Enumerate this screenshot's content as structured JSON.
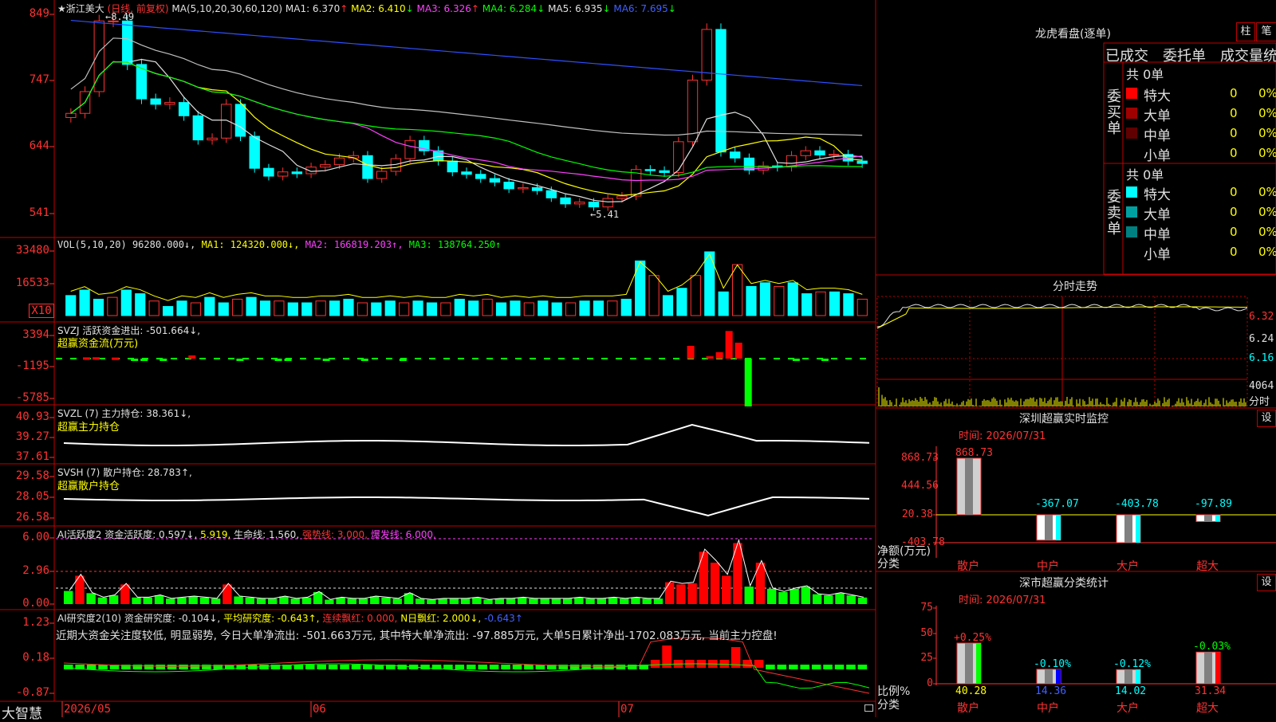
{
  "stock": {
    "name": "★浙江美大",
    "mode": "(日线, 前复权)",
    "ma_label": "MA(5,10,20,30,60,120)",
    "ma": [
      {
        "label": "MA1: 6.370",
        "arrow": "↑",
        "color": "#e0e0e0"
      },
      {
        "label": "MA2: 6.410",
        "arrow": "↓",
        "color": "#ffff00"
      },
      {
        "label": "MA3: 6.326",
        "arrow": "↑",
        "color": "#ff40ff"
      },
      {
        "label": "MA4: 6.284",
        "arrow": "↓",
        "color": "#00ff00"
      },
      {
        "label": "MA5: 6.935",
        "arrow": "↓",
        "color": "#e0e0e0"
      },
      {
        "label": "MA6: 7.695",
        "arrow": "↓",
        "color": "#4060ff"
      }
    ],
    "high_mark": "←8.49",
    "low_mark": "←5.41",
    "price_axis": [
      "849",
      "747",
      "644",
      "541"
    ],
    "closes": [
      6.96,
      7.32,
      8.49,
      8.49,
      7.77,
      7.2,
      7.11,
      7.14,
      6.92,
      6.52,
      6.55,
      7.11,
      6.58,
      6.05,
      5.92,
      5.99,
      5.96,
      6.07,
      6.11,
      6.22,
      6.26,
      5.88,
      6.0,
      6.21,
      6.51,
      6.34,
      6.17,
      5.99,
      5.95,
      5.88,
      5.82,
      5.71,
      5.73,
      5.68,
      5.56,
      5.46,
      5.49,
      5.41,
      5.55,
      5.59,
      6.03,
      6.01,
      5.98,
      6.49,
      7.51,
      8.35,
      6.32,
      6.22,
      6.02,
      6.09,
      6.07,
      6.26,
      6.34,
      6.27,
      6.28,
      6.17,
      6.13
    ]
  },
  "volume": {
    "header": "VOL(5,10,20)",
    "value": "96280.000↓,",
    "ma1": "MA1: 124320.000↓,",
    "ma2": "MA2: 166819.203↑,",
    "ma3": "MA3: 138764.250↑",
    "axis": [
      "33480",
      "16533",
      "X10"
    ],
    "values": [
      11000,
      14000,
      9000,
      10000,
      14000,
      12000,
      8000,
      5000,
      8000,
      7000,
      10000,
      7000,
      9000,
      10000,
      8000,
      8000,
      7000,
      7000,
      8000,
      8000,
      9000,
      7000,
      7000,
      8000,
      7000,
      8000,
      7000,
      7000,
      9000,
      8000,
      9000,
      7000,
      8000,
      7000,
      8000,
      7000,
      7000,
      8000,
      8000,
      8000,
      9000,
      30000,
      22000,
      11000,
      15000,
      22000,
      35000,
      13000,
      28000,
      16000,
      18000,
      16000,
      18000,
      12000,
      13000,
      13000,
      12000,
      9000
    ]
  },
  "svzj": {
    "header": "SVZJ  活跃资金进出: -501.664↓,",
    "sub": "超赢资金流(万元)",
    "axis": [
      "3394",
      "-1195",
      "-5785"
    ],
    "values": [
      -40,
      -30,
      120,
      130,
      -30,
      100,
      -30,
      -60,
      -60,
      -30,
      -150,
      -30,
      0,
      300,
      -30,
      -30,
      -30,
      -30,
      -90,
      -30,
      -30,
      -30,
      -200,
      -190,
      -30,
      -30,
      -30,
      -150,
      -30,
      -30,
      -30,
      -150,
      -30,
      -30,
      -30,
      -80,
      -30,
      -30,
      -30,
      -30,
      -30,
      -30,
      -30,
      -30,
      -30,
      -30,
      -30,
      -30,
      -30,
      -30,
      -30,
      -30,
      -30,
      -30,
      -30,
      -30,
      -30,
      -30,
      -30,
      -30,
      0,
      -30,
      -30,
      -30,
      -30,
      1200,
      -30,
      220,
      600,
      2600,
      1500,
      -4500,
      -30,
      -30,
      -30,
      -30,
      -150,
      -30,
      -30,
      -200,
      -30,
      -30,
      -30,
      -30
    ]
  },
  "svzl": {
    "header": "SVZL (7) 主力持仓: 38.361↓,",
    "sub": "超赢主力持仓",
    "axis": [
      "40.93",
      "39.27",
      "37.61"
    ]
  },
  "svsh": {
    "header": "SVSH (7) 散户持仓: 28.783↑,",
    "sub": "超赢散户持仓",
    "axis": [
      "29.58",
      "28.05",
      "26.58"
    ]
  },
  "ai_active": {
    "header": "AI活跃度2 资金活跃度: 0.597↓,",
    "v2": "5.919,",
    "life": "生命线: 1.560,",
    "strong": "强势线: 3.000,",
    "burst": "爆发线: 6.000,",
    "axis": [
      "6.00",
      "2.96",
      "0.00"
    ],
    "values": [
      1.2,
      2.6,
      1.0,
      0.6,
      0.8,
      1.8,
      0.6,
      0.6,
      0.8,
      0.5,
      0.6,
      0.7,
      0.6,
      0.5,
      1.8,
      0.7,
      0.6,
      0.5,
      0.5,
      0.7,
      0.5,
      0.6,
      1.1,
      0.4,
      0.6,
      0.5,
      0.5,
      0.7,
      0.6,
      0.5,
      1.0,
      0.5,
      0.4,
      0.5,
      0.5,
      0.5,
      0.6,
      0.4,
      0.5,
      0.5,
      0.6,
      0.5,
      0.5,
      0.5,
      0.5,
      0.6,
      0.5,
      0.5,
      0.6,
      0.5,
      0.6,
      0.5,
      0.5,
      2.0,
      1.8,
      1.9,
      4.8,
      3.8,
      2.6,
      5.6,
      1.6,
      3.8,
      1.4,
      1.1,
      1.4,
      1.6,
      0.9,
      0.8,
      1.0,
      0.8,
      0.6
    ]
  },
  "ai_research": {
    "header": "AI研究度2(10) 资金研究度: -0.104↓,",
    "avg": "平均研究度: -0.643↑,",
    "cons": "连续飘红: 0.000,",
    "nday": "N日飘红: 2.000↓,",
    "last": "-0.643↑",
    "summary": "近期大资金关注度较低, 明显弱势, 今日大单净流出: -501.663万元, 其中特大单净流出: -97.885万元, 大单5日累计净出-1702.083万元, 当前主力控盘!",
    "axis": [
      "1.23",
      "0.18",
      "-0.87"
    ]
  },
  "dates": [
    "2026/05",
    "06",
    "07"
  ],
  "footer_brand": "大智慧",
  "right": {
    "title": "龙虎看盘(逐单)",
    "btn_bar": "柱",
    "btn_pen": "笔",
    "tab_done": "已成交",
    "tab_order": "委托单",
    "tab_vol": "成交量统计",
    "buy_label": "委买单",
    "sell_label": "委卖单",
    "total_buy": "共 0单",
    "total_sell": "共 0单",
    "buy_rows": [
      {
        "label": "特大",
        "n": "0",
        "pct": "0%",
        "color": "#ff0000"
      },
      {
        "label": "大单",
        "n": "0",
        "pct": "0%",
        "color": "#a00000"
      },
      {
        "label": "中单",
        "n": "0",
        "pct": "0%",
        "color": "#600000"
      },
      {
        "label": "小单",
        "n": "0",
        "pct": "0%",
        "color": "#000000"
      }
    ],
    "sell_rows": [
      {
        "label": "特大",
        "n": "0",
        "pct": "0%",
        "color": "#00ffff"
      },
      {
        "label": "大单",
        "n": "0",
        "pct": "0%",
        "color": "#00a0a0"
      },
      {
        "label": "中单",
        "n": "0",
        "pct": "0%",
        "color": "#008080"
      },
      {
        "label": "小单",
        "n": "0",
        "pct": "0%",
        "color": "#000000"
      }
    ],
    "intraday_title": "分时走势",
    "intraday_axis": [
      "6.32",
      "6.24",
      "6.16"
    ],
    "intraday_vol_axis": [
      "4064",
      "分时"
    ],
    "sz_title": "深圳超赢实时监控",
    "sz_btn": "设",
    "sz_time": "时间: 2026/07/31",
    "sz_axis": [
      "868.73",
      "444.56",
      "20.38",
      "-403.78"
    ],
    "sz_ylabel": "净额(万元)",
    "sz_xlabel": "分类",
    "sz_bars": [
      {
        "cat": "散户",
        "value": "868.73"
      },
      {
        "cat": "中户",
        "value": "-367.07"
      },
      {
        "cat": "大户",
        "value": "-403.78"
      },
      {
        "cat": "超大",
        "value": "-97.89"
      }
    ],
    "ss_title": "深市超赢分类统计",
    "ss_btn": "设",
    "ss_time": "时间: 2026/07/31",
    "ss_axis": [
      "75",
      "50",
      "25",
      "0"
    ],
    "ss_ylabel": "比例%",
    "ss_xlabel": "分类",
    "ss_bars": [
      {
        "cat": "散户",
        "value": "40.28",
        "chg": "+0.25%"
      },
      {
        "cat": "中户",
        "value": "14.36",
        "chg": "-0.10%"
      },
      {
        "cat": "大户",
        "value": "14.02",
        "chg": "-0.12%"
      },
      {
        "cat": "超大",
        "value": "31.34",
        "chg": "-0.03%"
      }
    ]
  }
}
